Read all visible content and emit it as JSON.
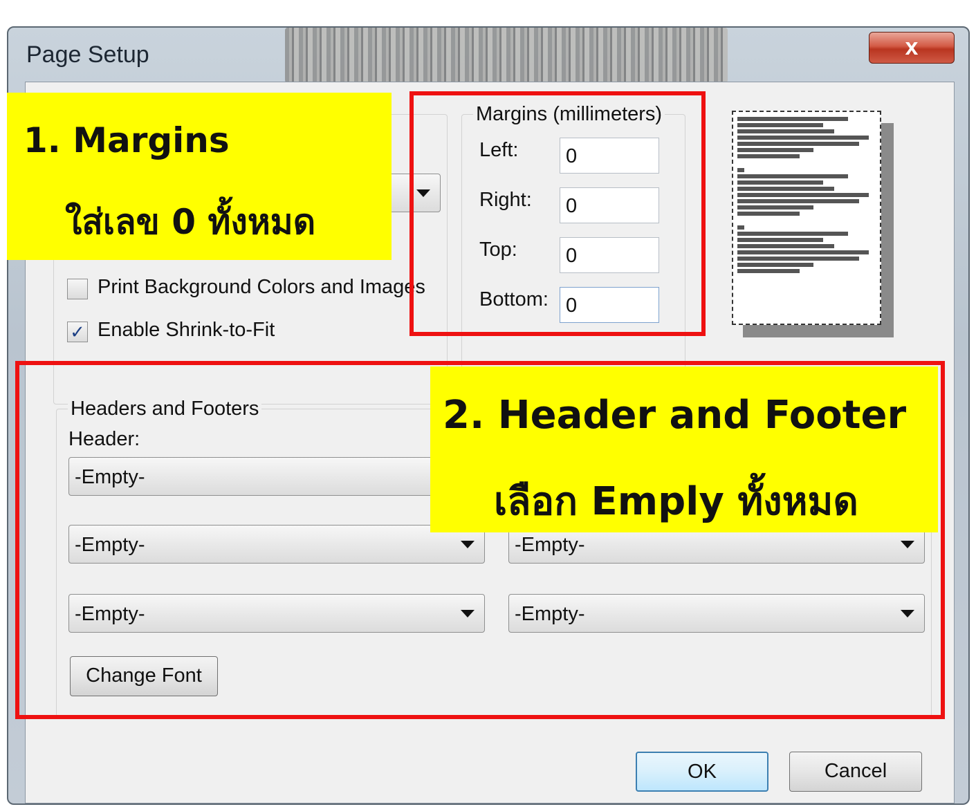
{
  "window": {
    "title": "Page Setup",
    "close_glyph": "x"
  },
  "margins": {
    "legend": "Margins (millimeters)",
    "left_label": "Left:",
    "left_value": "0",
    "right_label": "Right:",
    "right_value": "0",
    "top_label": "Top:",
    "top_value": "0",
    "bottom_label": "Bottom:",
    "bottom_value": "0"
  },
  "options": {
    "print_background_label": "Print Background Colors and Images",
    "print_background_checked": false,
    "shrink_label": "Enable Shrink-to-Fit",
    "shrink_checked": true,
    "check_glyph": "✓"
  },
  "headers_footers": {
    "legend": "Headers and Footers",
    "header_label": "Header:",
    "header_left": "-Empty-",
    "row2_left": "-Empty-",
    "row2_right": "-Empty-",
    "row3_left": "-Empty-",
    "row3_right": "-Empty-",
    "change_font_label": "Change Font"
  },
  "buttons": {
    "ok": "OK",
    "cancel": "Cancel"
  },
  "annotations": {
    "callout1_line1": "1. Margins",
    "callout1_line2": "ใส่เลข  0 ทั้งหมด",
    "callout2_line1": "2. Header and Footer",
    "callout2_line2": "เลือก Emply ทั้งหมด",
    "highlight_color": "#ffff00",
    "box_color": "#ee1111"
  }
}
